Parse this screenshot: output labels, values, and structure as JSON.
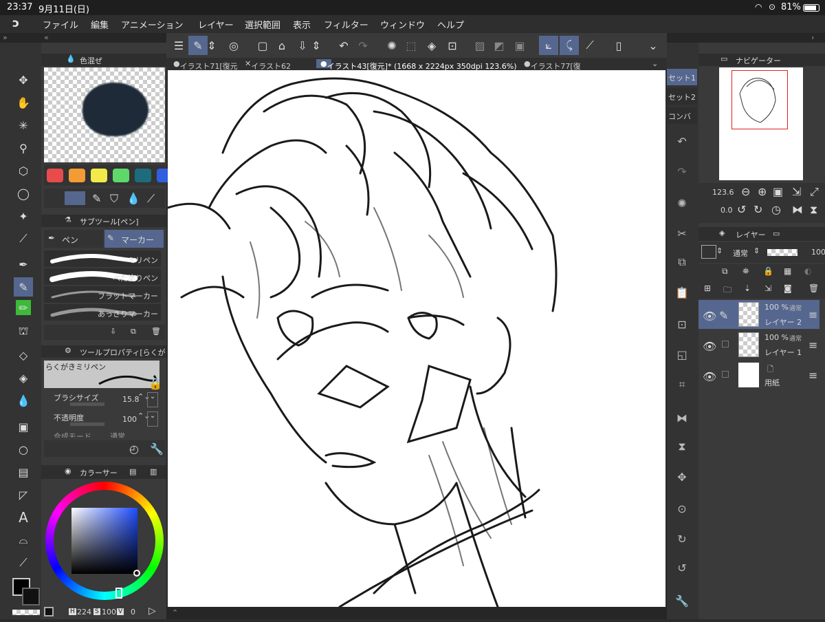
{
  "status": {
    "time": "23:37",
    "date": "9月11日(日)",
    "battery": "81%"
  },
  "menu": {
    "items": [
      "ファイル",
      "編集",
      "アニメーション",
      "レイヤー",
      "選択範囲",
      "表示",
      "フィルター",
      "ウィンドウ",
      "ヘルプ"
    ]
  },
  "tabs": {
    "items": [
      "イラスト71[復元",
      "イラスト62",
      "イラスト43[復元]* (1668 x 2224px 350dpi 123.6%)",
      "イラスト77[復"
    ]
  },
  "color_mix": {
    "title": "色混ぜ"
  },
  "palette": {
    "swatches": [
      "#e84b4b",
      "#f39b34",
      "#f2e94a",
      "#5fd86a",
      "#1e6b7b",
      "#2f5fe0"
    ]
  },
  "subtool": {
    "title": "サブツール[ペン]",
    "tab_pen": "ペン",
    "tab_marker": "マーカー",
    "brushes": [
      "ミリペン",
      "べた塗りペン",
      "フラットマーカー",
      "あっさりマーカー"
    ]
  },
  "tool_property": {
    "title": "ツールプロパティ[らくが",
    "preset": "らくがきミリペン",
    "brush_size_label": "ブラシサイズ",
    "brush_size": "15.8",
    "opacity_label": "不透明度",
    "opacity": "100",
    "blend_label": "合成モード",
    "blend_value": "通常"
  },
  "color_circle": {
    "title": "カラーサー",
    "h_label": "H",
    "h": "224",
    "s_label": "S",
    "s": "100",
    "v_label": "V",
    "v": "0"
  },
  "right_rail": {
    "sets": [
      "セット1",
      "セット2",
      "コンバ"
    ]
  },
  "navigator": {
    "title": "ナビゲーター",
    "zoom": "123.6",
    "rotation": "0.0"
  },
  "layers": {
    "title": "レイヤー",
    "blend": "通常",
    "opacity": "100",
    "items": [
      {
        "percent": "100 %",
        "mode": "通常",
        "name": "レイヤー 2"
      },
      {
        "percent": "100 %",
        "mode": "通常",
        "name": "レイヤー 1"
      },
      {
        "name": "用紙"
      }
    ]
  },
  "colors": {
    "accent": "#56678f",
    "panel": "#3a3a3a",
    "active_green": "#3cba3a"
  }
}
